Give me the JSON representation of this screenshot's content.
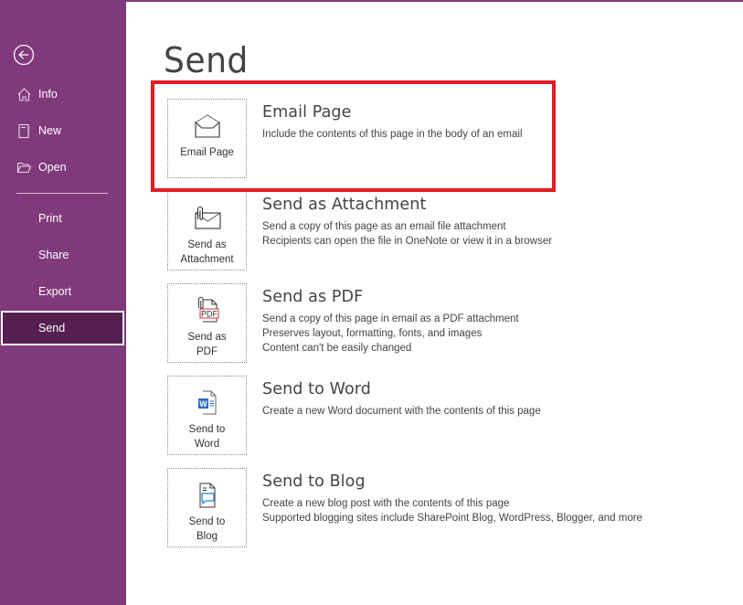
{
  "sidebar": {
    "back_icon": "back-arrow-circle-icon",
    "items": [
      {
        "label": "Info",
        "icon": "home-icon"
      },
      {
        "label": "New",
        "icon": "notebook-icon"
      },
      {
        "label": "Open",
        "icon": "folder-open-icon"
      },
      {
        "label": "Print"
      },
      {
        "label": "Share"
      },
      {
        "label": "Export"
      },
      {
        "label": "Send",
        "active": true
      }
    ]
  },
  "main": {
    "title": "Send",
    "options": [
      {
        "tile_label": "Email Page",
        "icon": "envelope-open-icon",
        "title": "Email Page",
        "description": [
          "Include the contents of this page in the body of an email"
        ],
        "highlighted": true
      },
      {
        "tile_label": "Send as Attachment",
        "icon": "envelope-attachment-icon",
        "title": "Send as Attachment",
        "description": [
          "Send a copy of this page as an email file attachment",
          "Recipients can open the file in OneNote or view it in a browser"
        ]
      },
      {
        "tile_label": "Send as PDF",
        "icon": "pdf-attachment-icon",
        "title": "Send as PDF",
        "description": [
          "Send a copy of this page in email as a PDF attachment",
          "Preserves layout, formatting, fonts, and images",
          "Content can't be easily changed"
        ]
      },
      {
        "tile_label": "Send to Word",
        "icon": "word-document-icon",
        "title": "Send to Word",
        "description": [
          "Create a new Word document with the contents of this page"
        ]
      },
      {
        "tile_label": "Send to Blog",
        "icon": "blog-post-icon",
        "title": "Send to Blog",
        "description": [
          "Create a new blog post with the contents of this page",
          "Supported blogging sites include SharePoint Blog, WordPress, Blogger, and more"
        ]
      }
    ]
  },
  "tile_labels_split": {
    "email": [
      "Email Page"
    ],
    "attachment": [
      "Send as",
      "Attachment"
    ],
    "pdf": [
      "Send as",
      "PDF"
    ],
    "word": [
      "Send to",
      "Word"
    ],
    "blog": [
      "Send to",
      "Blog"
    ]
  },
  "pdf_icon_text": "PDF",
  "word_icon_text": "W",
  "colors": {
    "sidebar_bg": "#80397b",
    "sidebar_active": "#552050",
    "highlight_border": "#e31b23",
    "word_blue": "#2b6cc4",
    "blog_blue": "#2b7cd3"
  }
}
